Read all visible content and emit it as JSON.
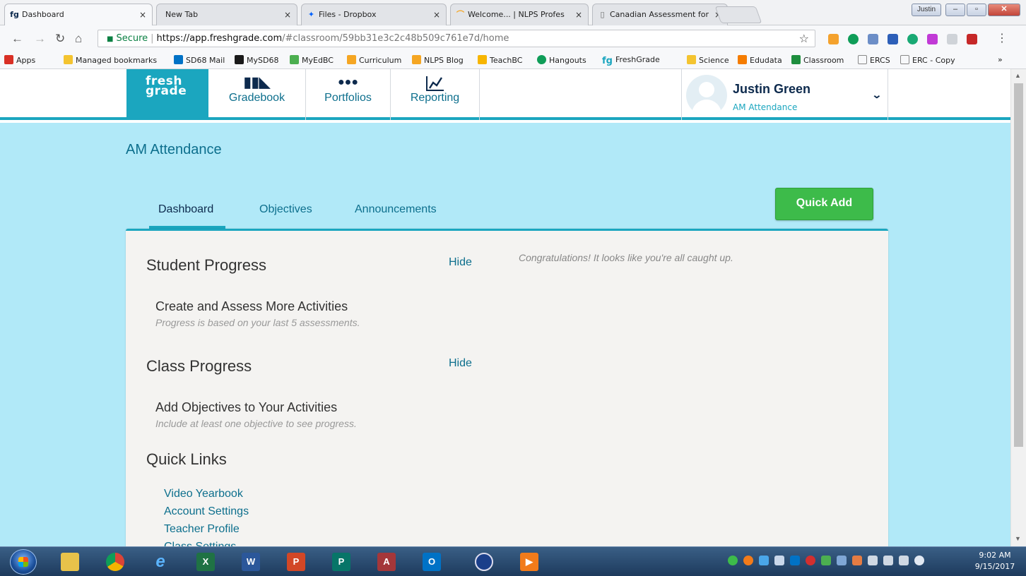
{
  "browser": {
    "tabs": [
      {
        "title": "Dashboard",
        "icon": "fg-icon",
        "active": true
      },
      {
        "title": "New Tab",
        "icon": "blank-icon"
      },
      {
        "title": "Files - Dropbox",
        "icon": "dropbox-icon"
      },
      {
        "title": "Welcome... | NLPS Profes",
        "icon": "nlps-icon"
      },
      {
        "title": "Canadian Assessment for",
        "icon": "document-icon"
      }
    ],
    "profile_name": "Justin",
    "security_label": "Secure",
    "url_host": "https://app.freshgrade.com",
    "url_path": "/#classroom/59bb31e3c2c48b509c761e7d/home",
    "bookmarks": [
      {
        "label": "Apps",
        "color": "#d93025"
      },
      {
        "label": "Managed bookmarks",
        "color": "#f4c430"
      },
      {
        "label": "SD68 Mail",
        "color": "#0072c6"
      },
      {
        "label": "MySD68",
        "color": "#1a1a1a"
      },
      {
        "label": "MyEdBC",
        "color": "#4caf50"
      },
      {
        "label": "Curriculum",
        "color": "#f5a623"
      },
      {
        "label": "NLPS Blog",
        "color": "#f5a623"
      },
      {
        "label": "TeachBC",
        "color": "#f7b500"
      },
      {
        "label": "Hangouts",
        "color": "#0f9d58"
      },
      {
        "label": "FreshGrade",
        "color": "#1ba6bf",
        "text_icon": "fg"
      },
      {
        "label": "Science",
        "color": "#f4c430"
      },
      {
        "label": "Edudata",
        "color": "#f57c00"
      },
      {
        "label": "Classroom",
        "color": "#1e8e3e"
      },
      {
        "label": "ERCS",
        "color": "#888888"
      },
      {
        "label": "ERC - Copy",
        "color": "#888888"
      }
    ],
    "bookmarks_overflow": "»"
  },
  "app": {
    "logo_line1": "fresh",
    "logo_line2": "grade",
    "nav": [
      {
        "label": "Gradebook",
        "icon": "gradebook-icon"
      },
      {
        "label": "Portfolios",
        "icon": "portfolios-icon"
      },
      {
        "label": "Reporting",
        "icon": "reporting-icon"
      }
    ],
    "user": {
      "name": "Justin Green",
      "class": "AM Attendance"
    },
    "class_title": "AM Attendance",
    "tabs": [
      {
        "label": "Dashboard",
        "active": true
      },
      {
        "label": "Objectives"
      },
      {
        "label": "Announcements"
      }
    ],
    "quick_add": "Quick Add",
    "congrats": "Congratulations! It looks like you're all caught up.",
    "student_progress": {
      "title": "Student Progress",
      "hide": "Hide",
      "item_title": "Create and Assess More Activities",
      "item_sub": "Progress is based on your last 5 assessments."
    },
    "class_progress": {
      "title": "Class Progress",
      "hide": "Hide",
      "item_title": "Add Objectives to Your Activities",
      "item_sub": "Include at least one objective to see progress."
    },
    "quick_links": {
      "title": "Quick Links",
      "links": [
        "Video Yearbook",
        "Account Settings",
        "Teacher Profile",
        "Class Settings"
      ]
    },
    "colors": {
      "brand": "#1ba6bf",
      "banner": "#b1e9f8",
      "quick_add": "#3dbb4a",
      "link": "#0d6f8d"
    }
  },
  "taskbar": {
    "apps": [
      "chrome-icon",
      "file-explorer-icon",
      "internet-explorer-icon",
      "excel-icon",
      "word-icon",
      "powerpoint-icon",
      "publisher-icon",
      "access-icon",
      "outlook-icon",
      "remote-desktop-icon",
      "media-player-icon"
    ],
    "time": "9:02 AM",
    "date": "9/15/2017"
  }
}
